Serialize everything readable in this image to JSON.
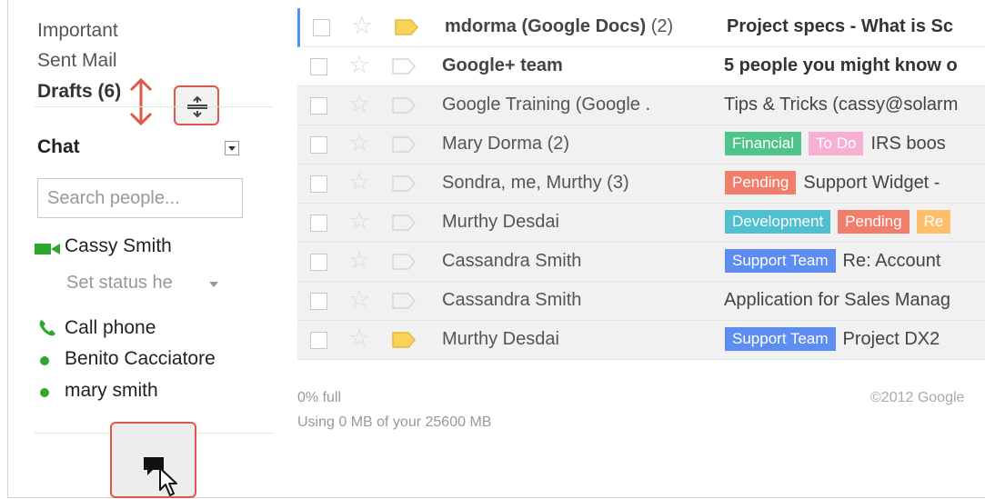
{
  "sidebar": {
    "items": [
      {
        "label": "Important"
      },
      {
        "label": "Sent Mail"
      },
      {
        "label": "Drafts",
        "count": "(6)"
      }
    ]
  },
  "chat": {
    "title": "Chat",
    "search_placeholder": "Search people...",
    "self_name": "Cassy Smith",
    "status_text": "Set status he",
    "contacts": [
      {
        "label": "Call phone",
        "icon": "phone-icon"
      },
      {
        "label": "Benito Cacciatore",
        "status": "online"
      },
      {
        "label": "mary smith",
        "status": "online"
      }
    ]
  },
  "colors": {
    "accent_red": "#d95a4a",
    "online_green": "#2fa72f",
    "label_financial": "#4ec38a",
    "label_todo": "#f7b0d4",
    "label_pending": "#f07e6a",
    "label_development": "#4fc0d0",
    "label_support": "#5d8df0",
    "label_orange": "#fdbf6a",
    "important_yellow": "#f7d35a"
  },
  "emails": [
    {
      "sender": "mdorma (Google Docs)",
      "count": "(2)",
      "subject": "Project specs - What is Sc",
      "unread": true,
      "important": true,
      "labels": []
    },
    {
      "sender": "Google+ team",
      "count": "",
      "subject": "5 people you might know o",
      "unread": true,
      "important": false,
      "labels": []
    },
    {
      "sender": "Google Training (Google .",
      "count": "",
      "subject": "Tips & Tricks (cassy@solarm",
      "unread": false,
      "important": false,
      "labels": []
    },
    {
      "sender": "Mary Dorma (2)",
      "count": "",
      "subject": "IRS boos",
      "unread": false,
      "important": false,
      "labels": [
        {
          "text": "Financial",
          "color": "#4ec38a"
        },
        {
          "text": "To Do",
          "color": "#f7b0d4"
        }
      ]
    },
    {
      "sender": "Sondra, me, Murthy (3)",
      "count": "",
      "subject": "Support Widget -",
      "unread": false,
      "important": false,
      "labels": [
        {
          "text": "Pending",
          "color": "#f07e6a"
        }
      ]
    },
    {
      "sender": "Murthy Desdai",
      "count": "",
      "subject": "",
      "unread": false,
      "important": false,
      "labels": [
        {
          "text": "Development",
          "color": "#4fc0d0"
        },
        {
          "text": "Pending",
          "color": "#f07e6a"
        },
        {
          "text": "Re",
          "color": "#fdbf6a"
        }
      ]
    },
    {
      "sender": "Cassandra Smith",
      "count": "",
      "subject": "Re: Account",
      "unread": false,
      "important": false,
      "labels": [
        {
          "text": "Support Team",
          "color": "#5d8df0"
        }
      ]
    },
    {
      "sender": "Cassandra Smith",
      "count": "",
      "subject": "Application for Sales Manag",
      "unread": false,
      "important": false,
      "labels": []
    },
    {
      "sender": "Murthy Desdai",
      "count": "",
      "subject": "Project DX2",
      "unread": false,
      "important": true,
      "labels": [
        {
          "text": "Support Team",
          "color": "#5d8df0"
        }
      ]
    }
  ],
  "footer": {
    "quota_percent": "0% full",
    "quota_usage": "Using 0 MB of your 25600 MB",
    "copyright": "©2012 Google"
  }
}
